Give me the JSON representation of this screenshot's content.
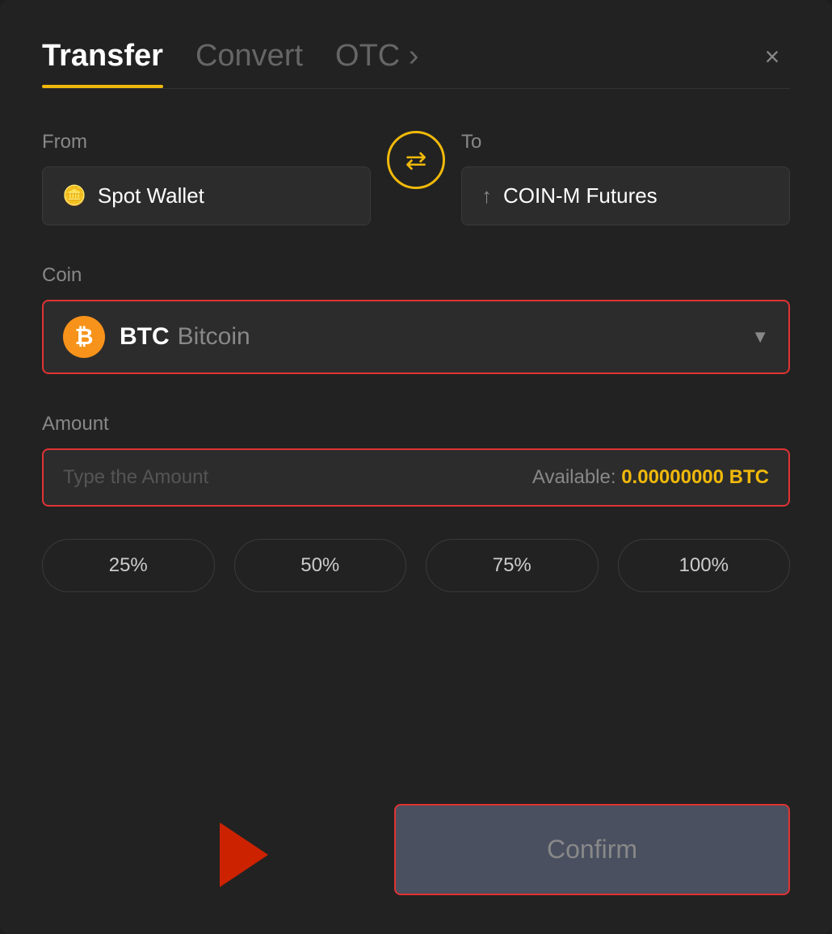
{
  "modal": {
    "close_label": "×"
  },
  "tabs": {
    "transfer": "Transfer",
    "convert": "Convert",
    "otc": "OTC ›"
  },
  "from": {
    "label": "From",
    "wallet": "Spot Wallet"
  },
  "to": {
    "label": "To",
    "wallet": "COIN-M Futures"
  },
  "coin": {
    "label": "Coin",
    "code": "BTC",
    "name": "Bitcoin"
  },
  "amount": {
    "label": "Amount",
    "placeholder": "Type the Amount",
    "available_label": "Available:",
    "available_value": "0.00000000 BTC"
  },
  "pct_buttons": [
    "25%",
    "50%",
    "75%",
    "100%"
  ],
  "confirm_button": "Confirm"
}
